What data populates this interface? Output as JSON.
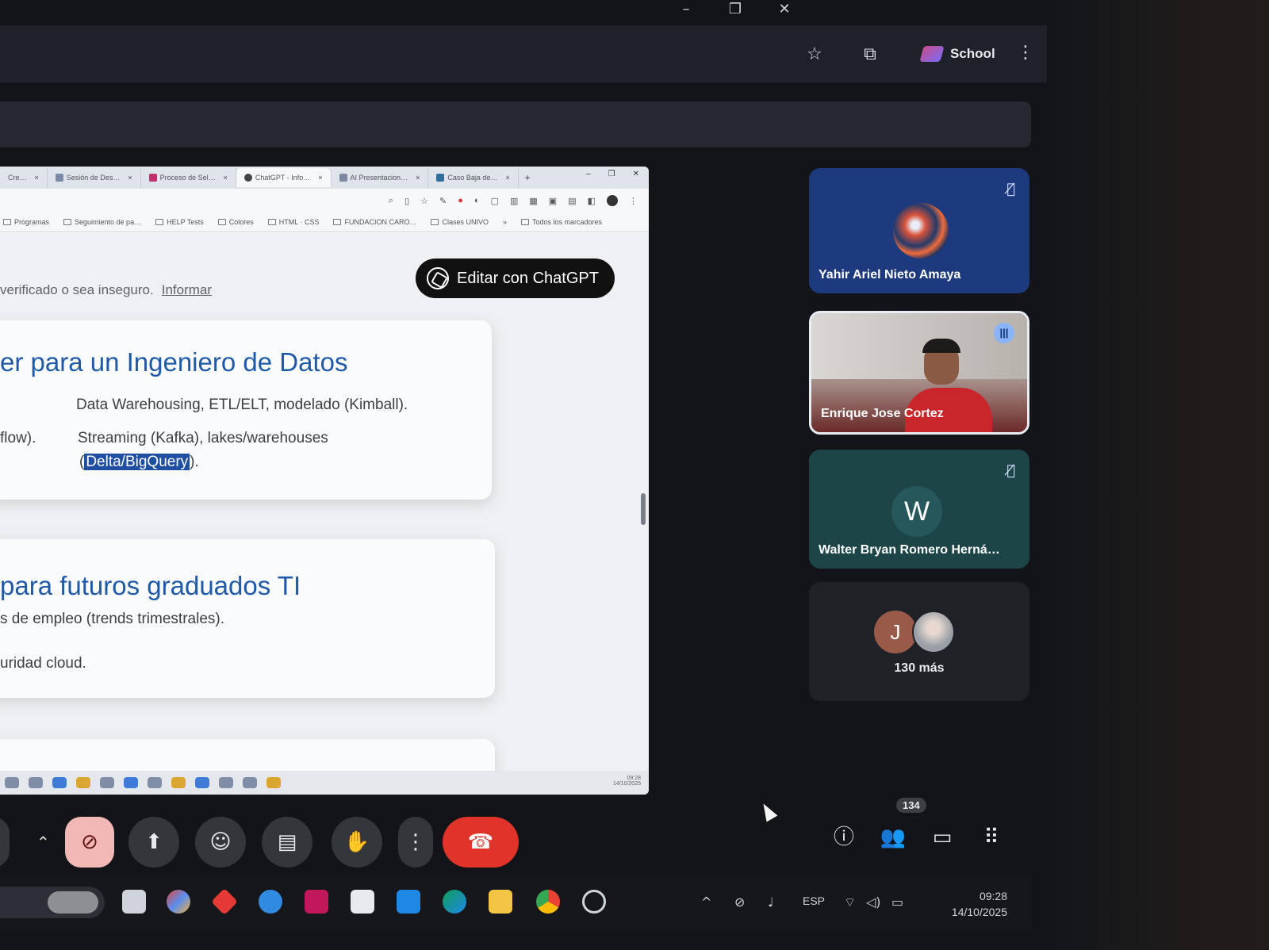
{
  "window_controls": {
    "minimize": "–",
    "maximize": "❐",
    "close": "✕"
  },
  "topbar": {
    "star_icon": "☆",
    "extensions_icon": "⧉",
    "profile_label": "School",
    "menu_icon": "⋮"
  },
  "shared_screen": {
    "tabs": [
      {
        "label": "Cre…"
      },
      {
        "label": "Sesión de Des…"
      },
      {
        "label": "Proceso de Sel…"
      },
      {
        "label": "ChatGPT - Info…",
        "active": true
      },
      {
        "label": "AI Presentacion…"
      },
      {
        "label": "Caso Baja de…"
      }
    ],
    "new_tab": "+",
    "bookmarks": [
      "Programas",
      "Seguimiento de pa…",
      "HELP Tests",
      "Colores",
      "HTML · CSS",
      "FUNDACION CARO…",
      "Clases UNIVO",
      "»",
      "Todos los marcadores"
    ],
    "warning_text": "verificado o sea inseguro.",
    "warning_link": "Informar",
    "edit_button": "Editar con ChatGPT",
    "card1": {
      "heading": "er para un Ingeniero de Datos",
      "line1": "Data Warehousing, ETL/ELT, modelado (Kimball).",
      "line2_left": "flow).",
      "line2": "Streaming (Kafka), lakes/warehouses",
      "line3_highlight": "Delta/BigQuery",
      "line3_tail": ")."
    },
    "card2": {
      "heading": "para futuros graduados TI",
      "line1": "s de empleo (trends trimestrales).",
      "line2": "uridad cloud."
    }
  },
  "participants": [
    {
      "name": "Yahir Ariel Nieto Amaya",
      "mic_icon": "🎙̸"
    },
    {
      "name": "Enrique Jose Cortez",
      "speaking_icon": "|||"
    },
    {
      "name": "Walter Bryan Romero Herná…",
      "initial": "W",
      "mic_icon": "🎙̸"
    },
    {
      "initial": "J",
      "more": "130 más"
    }
  ],
  "meet_controls": {
    "chevron": "⌃",
    "camera_off_icon": "⊘",
    "present_icon": "⬆",
    "emoji_icon": "☺",
    "captions_icon": "▤",
    "raise_hand_icon": "✋",
    "more_icon": "⋮",
    "end_call_icon": "☎",
    "info_icon": "ⓘ",
    "people_icon": "👥",
    "people_count": "134",
    "chat_icon": "▭",
    "activities_icon": "⠿"
  },
  "taskbar": {
    "language": "ESP",
    "time": "09:28",
    "date": "14/10/2025"
  },
  "colors": {
    "end_call": "#e0332a",
    "camera_off": "#f2b8b5",
    "heading_blue": "#1e5aa8",
    "tile_blue": "#1d3a7e",
    "tile_teal": "#1d4548"
  }
}
